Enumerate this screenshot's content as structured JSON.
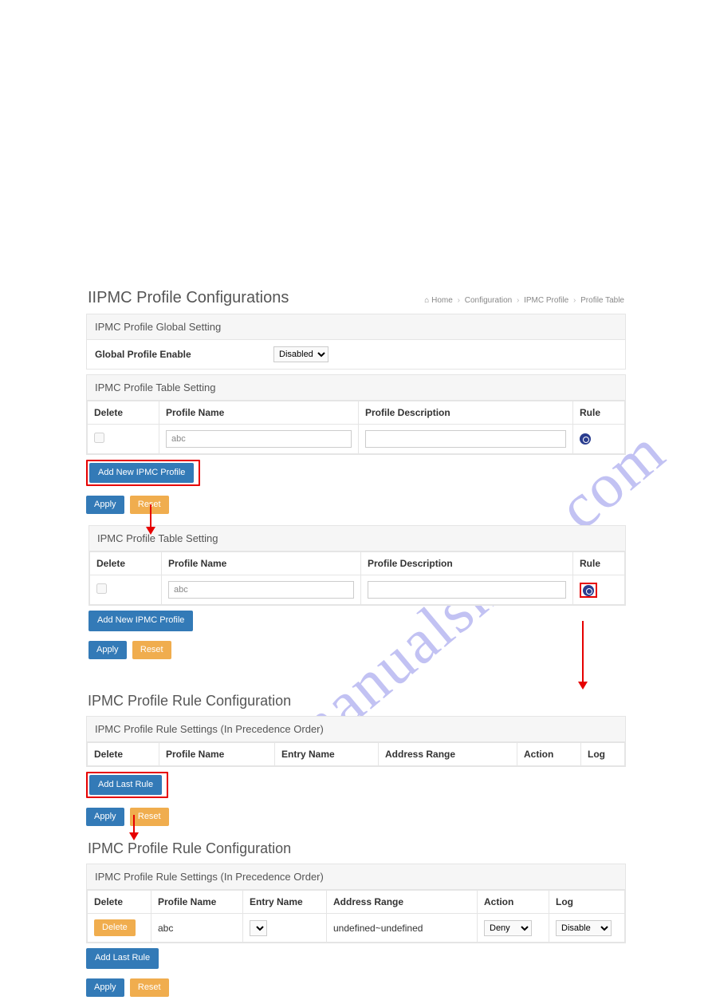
{
  "watermark": "manualshive.com",
  "section1": {
    "title": "IIPMC Profile Configurations",
    "breadcrumb": {
      "home": "Home",
      "b1": "Configuration",
      "b2": "IPMC Profile",
      "b3": "Profile Table"
    },
    "global_heading": "IPMC Profile Global Setting",
    "global_label": "Global Profile Enable",
    "global_value": "Disabled",
    "table_heading": "IPMC Profile Table Setting",
    "cols": {
      "delete": "Delete",
      "name": "Profile Name",
      "desc": "Profile Description",
      "rule": "Rule"
    },
    "row": {
      "name": "abc",
      "desc": ""
    },
    "add_btn": "Add New IPMC Profile",
    "apply": "Apply",
    "reset": "Reset"
  },
  "section2": {
    "table_heading": "IPMC Profile Table Setting",
    "cols": {
      "delete": "Delete",
      "name": "Profile Name",
      "desc": "Profile Description",
      "rule": "Rule"
    },
    "row": {
      "name": "abc",
      "desc": ""
    },
    "add_btn": "Add New IPMC Profile",
    "apply": "Apply",
    "reset": "Reset"
  },
  "section3": {
    "title": "IPMC Profile Rule Configuration",
    "heading": "IPMC Profile Rule Settings (In Precedence Order)",
    "cols": {
      "delete": "Delete",
      "name": "Profile Name",
      "entry": "Entry Name",
      "range": "Address Range",
      "action": "Action",
      "log": "Log"
    },
    "add_btn": "Add Last Rule",
    "apply": "Apply",
    "reset": "Reset"
  },
  "section4": {
    "title": "IPMC Profile Rule Configuration",
    "heading": "IPMC Profile Rule Settings (In Precedence Order)",
    "cols": {
      "delete": "Delete",
      "name": "Profile Name",
      "entry": "Entry Name",
      "range": "Address Range",
      "action": "Action",
      "log": "Log"
    },
    "row": {
      "delete_btn": "Delete",
      "name": "abc",
      "entry": "",
      "range": "undefined~undefined",
      "action": "Deny",
      "log": "Disable"
    },
    "add_btn": "Add Last Rule",
    "apply": "Apply",
    "reset": "Reset"
  }
}
